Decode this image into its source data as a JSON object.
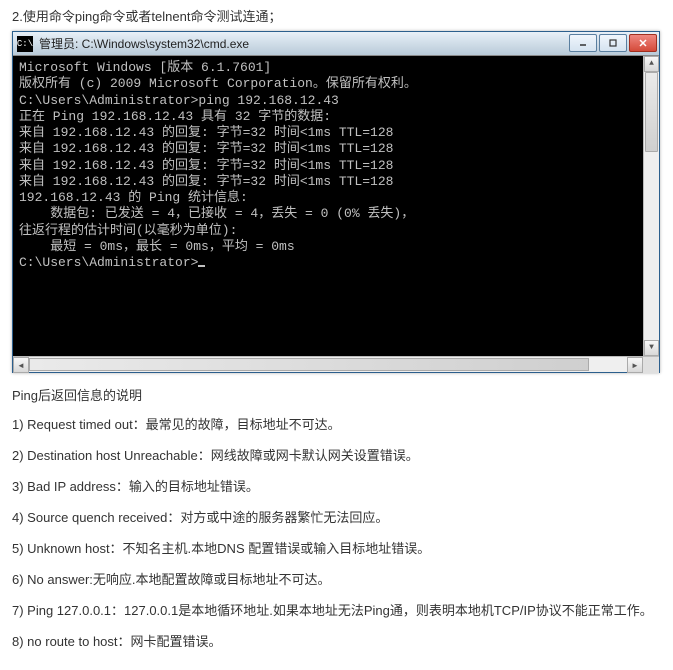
{
  "instruction": "2.使用命令ping命令或者telnent命令测试连通；",
  "titlebar": {
    "icon_text": "C:\\",
    "title": "管理员: C:\\Windows\\system32\\cmd.exe"
  },
  "cmd_lines": [
    "Microsoft Windows [版本 6.1.7601]",
    "版权所有 (c) 2009 Microsoft Corporation。保留所有权利。",
    "",
    "C:\\Users\\Administrator>ping 192.168.12.43",
    "",
    "正在 Ping 192.168.12.43 具有 32 字节的数据:",
    "来自 192.168.12.43 的回复: 字节=32 时间<1ms TTL=128",
    "来自 192.168.12.43 的回复: 字节=32 时间<1ms TTL=128",
    "来自 192.168.12.43 的回复: 字节=32 时间<1ms TTL=128",
    "来自 192.168.12.43 的回复: 字节=32 时间<1ms TTL=128",
    "",
    "192.168.12.43 的 Ping 统计信息:",
    "    数据包: 已发送 = 4，已接收 = 4，丢失 = 0 (0% 丢失)，",
    "往返行程的估计时间(以毫秒为单位):",
    "    最短 = 0ms，最长 = 0ms，平均 = 0ms",
    "",
    "C:\\Users\\Administrator>"
  ],
  "prompt_cursor": "_",
  "notes": {
    "title": "Ping后返回信息的说明",
    "items": [
      "1) Request timed out：最常见的故障，目标地址不可达。",
      "2) Destination host Unreachable：网线故障或网卡默认网关设置错误。",
      "3) Bad IP address：输入的目标地址错误。",
      "4) Source quench received：对方或中途的服务器繁忙无法回应。",
      "5) Unknown host：不知名主机.本地DNS 配置错误或输入目标地址错误。",
      "6) No answer:无响应.本地配置故障或目标地址不可达。",
      "7) Ping 127.0.0.1：127.0.0.1是本地循环地址.如果本地址无法Ping通，则表明本地机TCP/IP协议不能正常工作。",
      "8) no route to host：网卡配置错误。"
    ]
  }
}
